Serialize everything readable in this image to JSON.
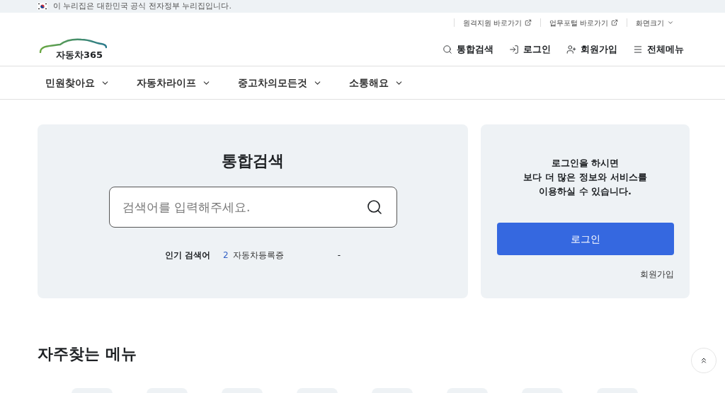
{
  "gov_banner": {
    "text": "이 누리집은 대한민국 공식 전자정부 누리집입니다."
  },
  "utility_links": [
    {
      "label": "원격지원 바로가기",
      "kind": "external"
    },
    {
      "label": "업무포털 바로가기",
      "kind": "external"
    },
    {
      "label": "화면크기",
      "kind": "dropdown"
    }
  ],
  "logo": {
    "text": "자동차365"
  },
  "header_actions": [
    {
      "label": "통합검색",
      "kind": "search"
    },
    {
      "label": "로그인",
      "kind": "login"
    },
    {
      "label": "회원가입",
      "kind": "signup"
    },
    {
      "label": "전체메뉴",
      "kind": "menu"
    }
  ],
  "nav": [
    {
      "label": "민원찾아요"
    },
    {
      "label": "자동차라이프"
    },
    {
      "label": "중고차의모든것"
    },
    {
      "label": "소통해요"
    }
  ],
  "search": {
    "title": "통합검색",
    "placeholder": "검색어를 입력해주세요.",
    "popular_label": "인기 검색어",
    "popular": [
      {
        "rank": "2",
        "term": "자동차등록증"
      }
    ],
    "separator": "-"
  },
  "login_card": {
    "message": [
      "로그인을 하시면",
      "보다 더 많은 정보와 서비스를",
      "이용하실 수 있습니다."
    ],
    "button": "로그인",
    "signup": "회원가입"
  },
  "quick_menu": {
    "title": "자주찾는 메뉴",
    "tiles": [
      {
        "kind": "blank"
      },
      {
        "kind": "blank"
      },
      {
        "kind": "blank"
      },
      {
        "kind": "blank"
      },
      {
        "kind": "blank"
      },
      {
        "kind": "blank"
      },
      {
        "kind": "blank"
      },
      {
        "kind": "blank"
      }
    ]
  }
}
